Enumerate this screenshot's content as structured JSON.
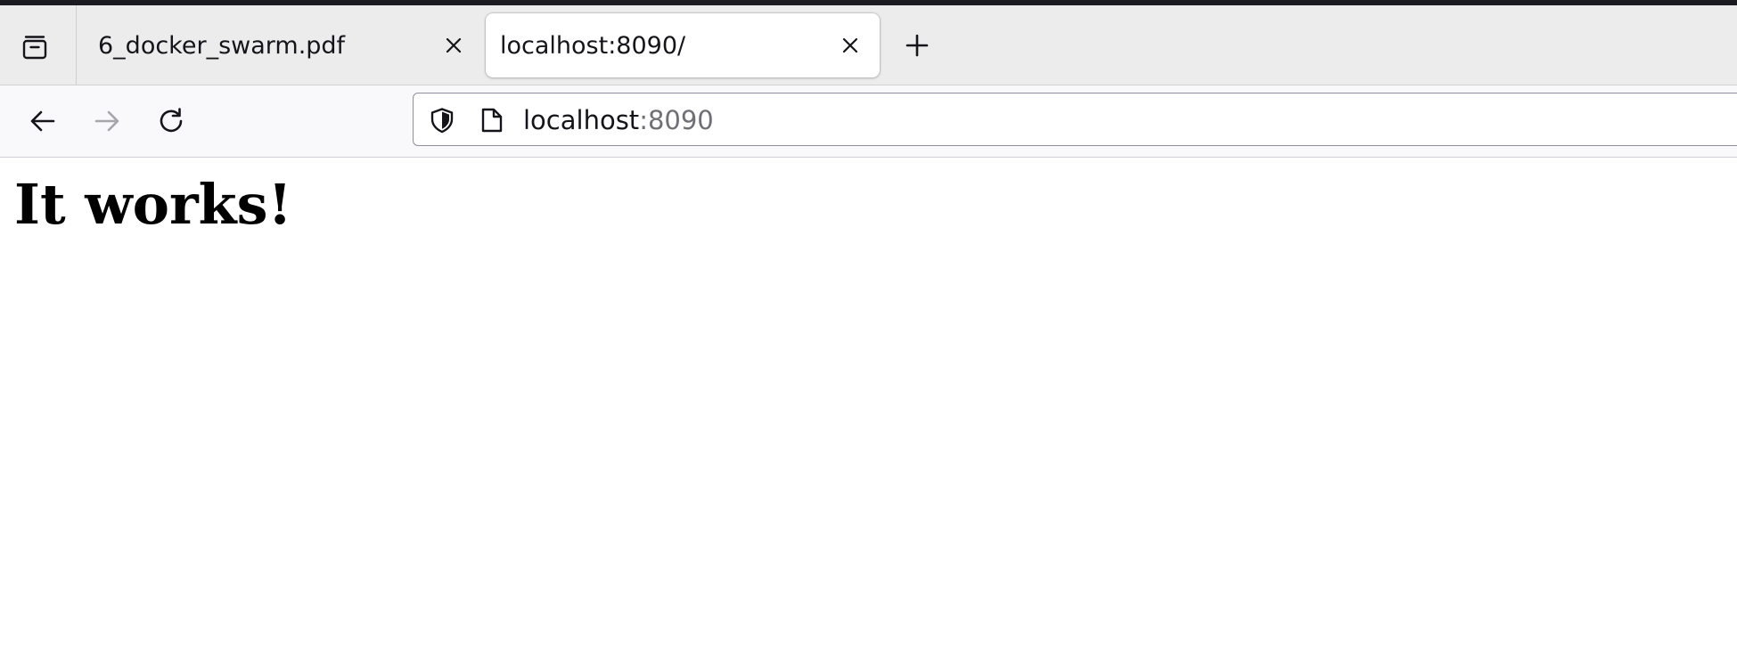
{
  "browser": {
    "tabs": [
      {
        "title": "6_docker_swarm.pdf",
        "active": false
      },
      {
        "title": "localhost:8090/",
        "active": true
      }
    ],
    "address_bar": {
      "host": "localhost",
      "port": ":8090"
    }
  },
  "page": {
    "heading": "It works!"
  },
  "icons": {
    "tab_list": "tab-list-icon",
    "close": "close-icon",
    "new_tab": "plus-icon",
    "back": "arrow-left-icon",
    "forward": "arrow-right-icon",
    "reload": "reload-icon",
    "security": "shield-icon",
    "page": "page-icon"
  },
  "colors": {
    "tab_bar": "#ececec",
    "nav_bar": "#f9f9fb",
    "text": "#15141a",
    "port_text": "#6f6f76",
    "disabled_icon": "#a6a6ad"
  }
}
